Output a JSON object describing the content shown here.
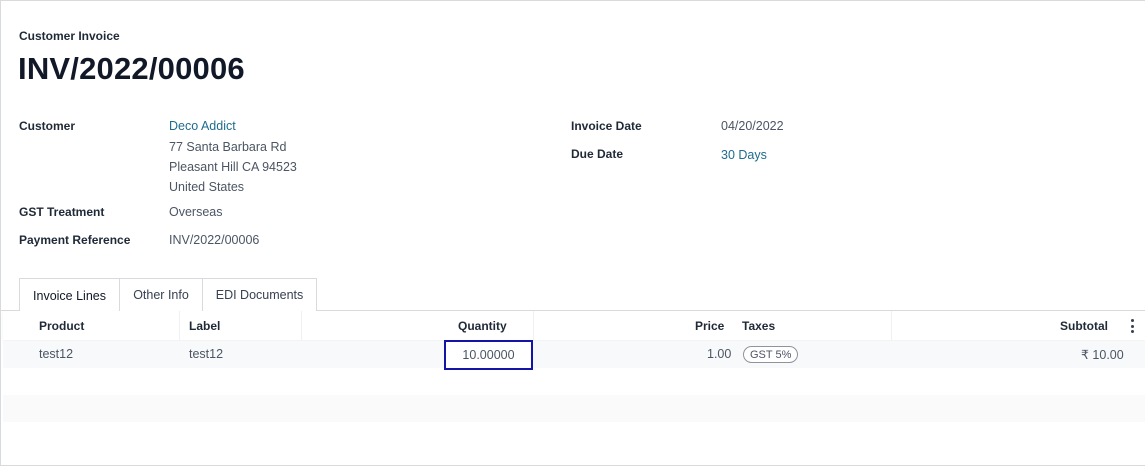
{
  "header": {
    "doc_type": "Customer Invoice",
    "title": "INV/2022/00006"
  },
  "customer": {
    "label": "Customer",
    "name": "Deco Addict",
    "address_line1": "77 Santa Barbara Rd",
    "address_line2": "Pleasant Hill CA 94523",
    "address_line3": "United States"
  },
  "gst_treatment": {
    "label": "GST Treatment",
    "value": "Overseas"
  },
  "payment_reference": {
    "label": "Payment Reference",
    "value": "INV/2022/00006"
  },
  "invoice_date": {
    "label": "Invoice Date",
    "value": "04/20/2022"
  },
  "due_date": {
    "label": "Due Date",
    "value": "30 Days"
  },
  "tabs": [
    {
      "label": "Invoice Lines",
      "active": true
    },
    {
      "label": "Other Info",
      "active": false
    },
    {
      "label": "EDI Documents",
      "active": false
    }
  ],
  "table": {
    "columns": {
      "product": "Product",
      "label": "Label",
      "quantity": "Quantity",
      "price": "Price",
      "taxes": "Taxes",
      "subtotal": "Subtotal"
    },
    "rows": [
      {
        "product": "test12",
        "label": "test12",
        "quantity": "10.00000",
        "price": "1.00",
        "taxes": "GST 5%",
        "subtotal": "₹ 10.00"
      }
    ]
  },
  "colors": {
    "link": "#1f6b8e",
    "focus_border": "#1414a8"
  }
}
